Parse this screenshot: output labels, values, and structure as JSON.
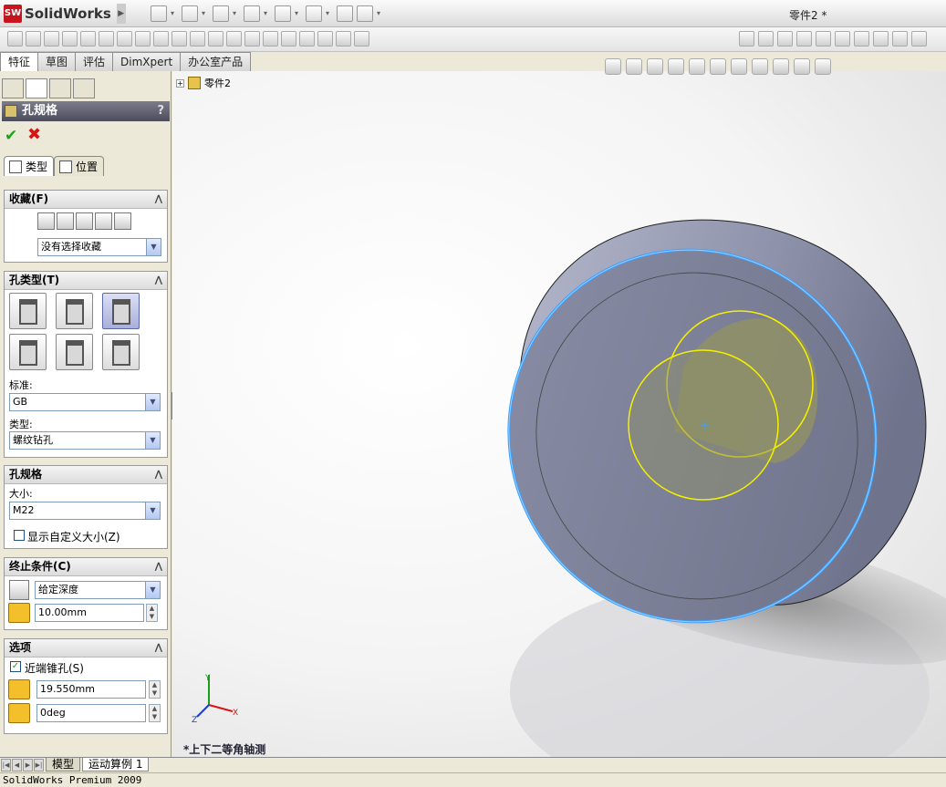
{
  "app": {
    "logo_text": "SolidWorks",
    "logo_badge": "SW",
    "document_title": "零件2 *"
  },
  "tabs": [
    "特征",
    "草图",
    "评估",
    "DimXpert",
    "办公室产品"
  ],
  "panel": {
    "title": "孔规格",
    "help": "?",
    "ok_glyph": "✔",
    "cancel_glyph": "✖",
    "subtabs": [
      "类型",
      "位置"
    ],
    "favorites": {
      "header": "收藏(F)",
      "select_value": "没有选择收藏"
    },
    "hole_type": {
      "header": "孔类型(T)",
      "standard_label": "标准:",
      "standard_value": "GB",
      "type_label": "类型:",
      "type_value": "螺纹钻孔"
    },
    "hole_spec": {
      "header": "孔规格",
      "size_label": "大小:",
      "size_value": "M22",
      "custom_size_label": "显示自定义大小(Z)"
    },
    "end_condition": {
      "header": "终止条件(C)",
      "condition_value": "给定深度",
      "depth_value": "10.00mm"
    },
    "options": {
      "header": "选项",
      "near_countersink_label": "近端锥孔(S)",
      "diameter_value": "19.550mm",
      "angle_value": "0deg"
    }
  },
  "viewport": {
    "tree_item": "零件2",
    "view_orientation": "*上下二等角轴测",
    "triad": {
      "x": "X",
      "y": "Y",
      "z": "Z"
    }
  },
  "bottom_tabs": [
    "模型",
    "运动算例 1"
  ],
  "statusbar": "SolidWorks Premium 2009",
  "colors": {
    "body": "#8a8fa8",
    "sketch": "#f5f000",
    "highlight": "#3aa0ff",
    "title_gradient_top": "#7b7b8a"
  }
}
